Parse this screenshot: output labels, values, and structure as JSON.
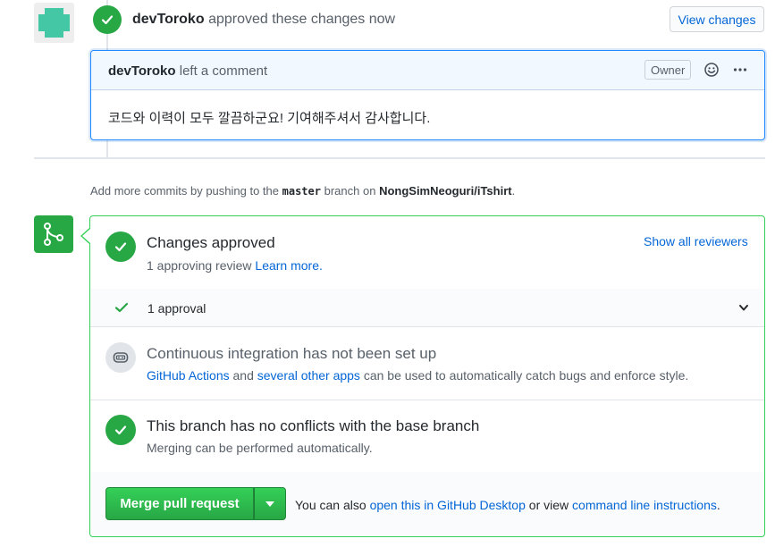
{
  "review": {
    "reviewer": "devToroko",
    "action_text": "approved these changes now",
    "view_changes_label": "View changes"
  },
  "comment": {
    "author": "devToroko",
    "action_text": "left a comment",
    "owner_badge": "Owner",
    "body": "코드와 이력이 모두 깔끔하군요! 기여해주셔서 감사합니다."
  },
  "hint": {
    "prefix": "Add more commits by pushing to the",
    "branch": "master",
    "middle": "branch on",
    "repo": "NongSimNeoguri/iTshirt",
    "suffix": "."
  },
  "merge_box": {
    "approved_title": "Changes approved",
    "approved_sub": "1 approving review",
    "learn_more": "Learn more.",
    "show_all_reviewers": "Show all reviewers",
    "approval_count": "1 approval",
    "ci_title": "Continuous integration has not been set up",
    "ci_link1": "GitHub Actions",
    "ci_and": "and",
    "ci_link2": "several other apps",
    "ci_rest": "can be used to automatically catch bugs and enforce style.",
    "conflict_title": "This branch has no conflicts with the base branch",
    "conflict_sub": "Merging can be performed automatically.",
    "merge_button": "Merge pull request",
    "footer_prefix": "You can also",
    "footer_link1": "open this in GitHub Desktop",
    "footer_middle": "or view",
    "footer_link2": "command line instructions",
    "footer_suffix": "."
  },
  "colors": {
    "green": "#28a745",
    "link": "#0366d6",
    "avatar": "#44c7a4"
  },
  "icons": [
    "check-icon",
    "smiley-icon",
    "kebab-horizontal-icon",
    "git-merge-icon",
    "chevron-down-icon",
    "ci-icon",
    "triangle-down-icon"
  ]
}
